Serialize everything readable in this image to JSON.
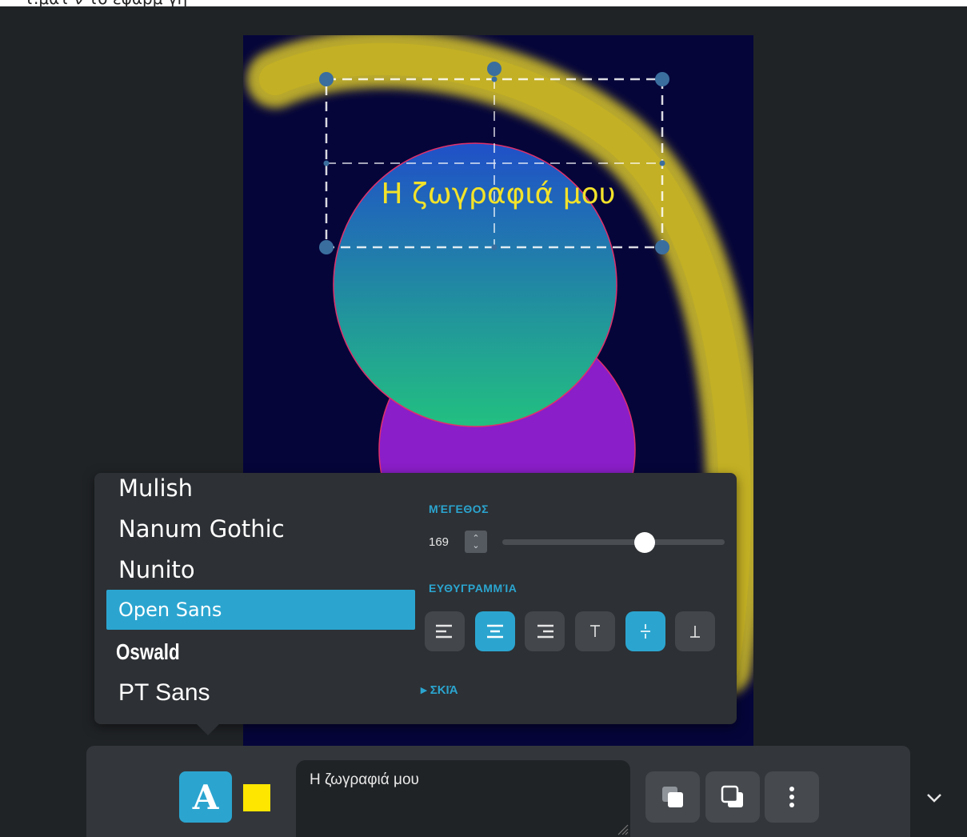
{
  "canvas": {
    "title": "Η ζωγραφιά μου",
    "colors": {
      "background": "#05053a",
      "stroke_yellow": "#d8c52a",
      "circle_gradient_top": "#2050c8",
      "circle_gradient_bottom": "#22c080",
      "circle_purple": "#8a1ec8",
      "handle": "#3a6e9e"
    }
  },
  "font_panel": {
    "fonts": [
      "Mulish",
      "Nanum Gothic",
      "Nunito",
      "Open Sans",
      "Oswald",
      "PT Sans"
    ],
    "selected_font": "Open Sans",
    "size_label": "ΜΈΓΕΘΟΣ",
    "size_value": "169",
    "size_slider_percent": 64,
    "alignment_label": "ΕΥΘΥΓΡΑΜΜΊΑ",
    "alignment_buttons": [
      {
        "icon": "align-left-icon",
        "active": false
      },
      {
        "icon": "align-center-icon",
        "active": true
      },
      {
        "icon": "align-right-icon",
        "active": false
      },
      {
        "icon": "align-top-icon",
        "active": false
      },
      {
        "icon": "align-middle-icon",
        "active": true
      },
      {
        "icon": "align-bottom-icon",
        "active": false
      }
    ],
    "shadow_label": "▸ ΣΚΙΆ"
  },
  "toolbar": {
    "text_mode_label": "A",
    "color_swatch": "#ffe600",
    "text_value": "Η ζωγραφιά μου",
    "buttons": [
      "bring-forward-icon",
      "send-backward-icon",
      "more-options-icon"
    ]
  },
  "accent_color": "#2ba5d0"
}
